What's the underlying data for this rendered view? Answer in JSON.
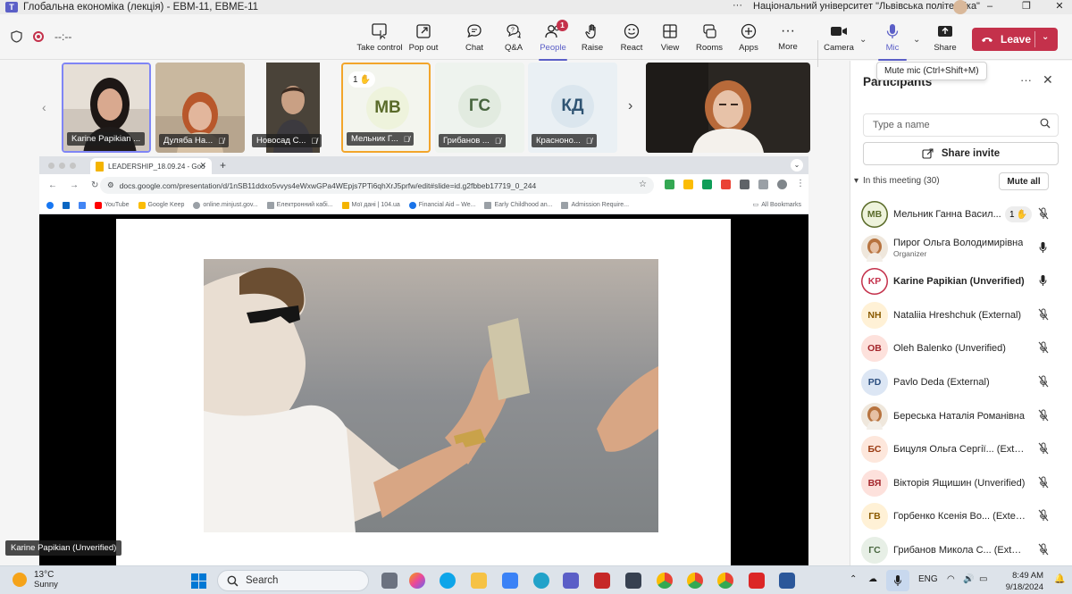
{
  "window": {
    "title": "Глобальна економіка (лекція) - ЕВМ-11, ЕВМЕ-11",
    "organization": "Національний університет \"Львівська політехніка\""
  },
  "toolbar": {
    "timer": "--:--",
    "buttons": [
      {
        "label": "Take control",
        "icon": "take-control-icon"
      },
      {
        "label": "Pop out",
        "icon": "pop-out-icon"
      },
      {
        "label": "Chat",
        "icon": "chat-icon"
      },
      {
        "label": "Q&A",
        "icon": "qa-icon"
      },
      {
        "label": "People",
        "icon": "people-icon",
        "badge": "1"
      },
      {
        "label": "Raise",
        "icon": "hand-icon"
      },
      {
        "label": "React",
        "icon": "react-icon"
      },
      {
        "label": "View",
        "icon": "view-icon"
      },
      {
        "label": "Rooms",
        "icon": "rooms-icon"
      },
      {
        "label": "Apps",
        "icon": "apps-icon"
      },
      {
        "label": "More",
        "icon": "more-icon"
      },
      {
        "label": "Camera",
        "icon": "camera-icon"
      },
      {
        "label": "Mic",
        "icon": "mic-icon"
      },
      {
        "label": "Share",
        "icon": "share-icon"
      }
    ],
    "leave_label": "Leave",
    "accent_color": "#5b5fc7",
    "leave_color": "#c4314b"
  },
  "tooltip": "Mute mic (Ctrl+Shift+M)",
  "gallery": {
    "tiles": [
      {
        "name": "Karine Papikian ...",
        "type": "video",
        "mic_off": false
      },
      {
        "name": "Дуляба На...",
        "type": "video",
        "mic_off": true
      },
      {
        "name": "Новосад С...",
        "type": "video",
        "mic_off": true
      },
      {
        "name": "Мельник Г...",
        "initials": "МВ",
        "type": "avatar",
        "hand_count": "1",
        "mic_off": true,
        "bg": "#eef3dc",
        "fg": "#5a6b2a"
      },
      {
        "name": "Грибанов ...",
        "initials": "ГС",
        "type": "avatar",
        "mic_off": true,
        "bg": "#e7efe6",
        "fg": "#48663f"
      },
      {
        "name": "Красноно...",
        "initials": "КД",
        "type": "avatar",
        "mic_off": true,
        "bg": "#e2ebf2",
        "fg": "#2f5473"
      }
    ]
  },
  "browser": {
    "tab_title": "LEADERSHIP_18.09.24 - Goo",
    "url": "docs.google.com/presentation/d/1nSB11ddxo5vvys4eWxwGPa4WEpjs7PTi6qhXrJ5prfw/edit#slide=id.g2fbbeb17719_0_244",
    "bookmarks": [
      "YouTube",
      "Google Keep",
      "online.minjust.gov...",
      "Електронний кабі...",
      "Мої дані | 104.ua",
      "Financial Aid – We...",
      "Early Childhood an...",
      "Admission Require..."
    ],
    "all_bookmarks": "All Bookmarks"
  },
  "presenter_label": "Karine Papikian (Unverified)",
  "panel": {
    "title": "Participants",
    "search_placeholder": "Type a name",
    "share_invite": "Share invite",
    "section_label": "In this meeting (30)",
    "mute_all": "Mute all",
    "participants": [
      {
        "initials": "МВ",
        "name": "Мельник Ганна Васил...",
        "hand": "1",
        "mic": "off",
        "bg": "#eef3dc",
        "fg": "#5a6b2a",
        "ring": true
      },
      {
        "initials": "",
        "name": "Пирог Ольга Володимирівна",
        "role": "Organizer",
        "mic": "on",
        "photo": true
      },
      {
        "initials": "KP",
        "name": "Karine Papikian (Unverified)",
        "mic": "on",
        "bold": true,
        "bg": "#ffffff",
        "fg": "#c4314b",
        "ring": true
      },
      {
        "initials": "NH",
        "name": "Nataliia Hreshchuk (External)",
        "mic": "off",
        "bg": "#fff1d6",
        "fg": "#8a5a00"
      },
      {
        "initials": "OB",
        "name": "Oleh Balenko (Unverified)",
        "mic": "off",
        "bg": "#fde1dc",
        "fg": "#a4262c"
      },
      {
        "initials": "PD",
        "name": "Pavlo Deda (External)",
        "mic": "off",
        "bg": "#dce6f4",
        "fg": "#2c4f80"
      },
      {
        "initials": "",
        "name": "Береська Наталія Романівна",
        "mic": "off",
        "photo": true
      },
      {
        "initials": "БС",
        "name": "Бицуля Ольга Сергії... (External)",
        "mic": "off",
        "bg": "#fde7dc",
        "fg": "#9a3b12"
      },
      {
        "initials": "ВЯ",
        "name": "Вікторія Ящишин (Unverified)",
        "mic": "off",
        "bg": "#fde1dc",
        "fg": "#a4262c"
      },
      {
        "initials": "ГВ",
        "name": "Горбенко Ксенія Во... (External)",
        "mic": "off",
        "bg": "#fff1d6",
        "fg": "#8a5a00"
      },
      {
        "initials": "ГС",
        "name": "Грибанов Микола С... (External)",
        "mic": "off",
        "bg": "#e7efe6",
        "fg": "#48663f"
      }
    ]
  },
  "taskbar": {
    "temperature": "13°C",
    "condition": "Sunny",
    "search_label": "Search",
    "language": "ENG",
    "time": "8:49 AM",
    "date": "9/18/2024"
  }
}
